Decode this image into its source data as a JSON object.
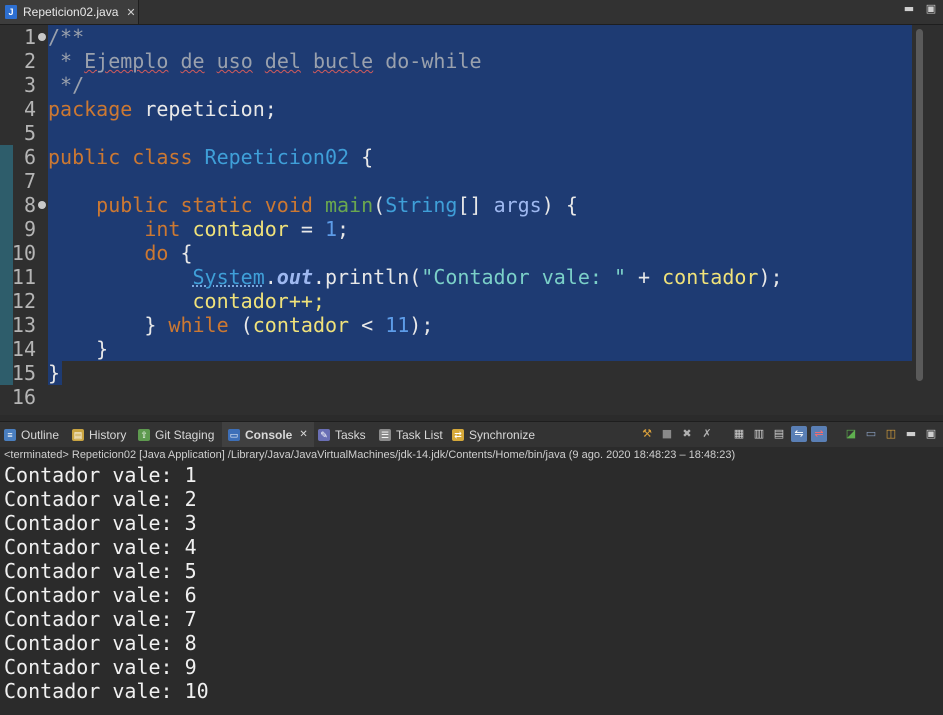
{
  "editor_tab": {
    "title": "Repeticion02.java",
    "close": "✕"
  },
  "window_buttons": {
    "minimize": "▬",
    "maximize": "▣"
  },
  "code": {
    "line_numbers": [
      "1",
      "2",
      "3",
      "4",
      "5",
      "6",
      "7",
      "8",
      "9",
      "10",
      "11",
      "12",
      "13",
      "14",
      "15",
      "16"
    ],
    "l1": "/**",
    "l2_a": " * ",
    "l2_b": "Ejemplo",
    "l2_c": " ",
    "l2_d": "de",
    "l2_e": " ",
    "l2_f": "uso",
    "l2_g": " ",
    "l2_h": "del",
    "l2_i": " ",
    "l2_j": "bucle",
    "l2_k": " do-while",
    "l3": " */",
    "l4_kw": "package",
    "l4_rest": " repeticion;",
    "l6_kw": "public class",
    "l6_cls": "Repeticion02",
    "l6_rest": " {",
    "l8_kw": "public static void",
    "l8_mth": "main",
    "l8_p1": "(",
    "l8_typ": "String",
    "l8_p2": "[] ",
    "l8_prm": "args",
    "l8_p3": ") {",
    "l9_kw": "int",
    "l9_var": "contador",
    "l9_eq": " = ",
    "l9_num": "1",
    "l9_end": ";",
    "l10_kw": "do",
    "l10_rest": " {",
    "l11_sys": "System",
    "l11_dot": ".",
    "l11_out": "out",
    "l11_m": ".println(",
    "l11_str": "\"Contador vale: \"",
    "l11_plus": " + ",
    "l11_var": "contador",
    "l11_end": ");",
    "l12": "contador++;",
    "l13_a": "} ",
    "l13_kw": "while",
    "l13_b": " (",
    "l13_var": "contador",
    "l13_c": " < ",
    "l13_num": "11",
    "l13_d": ");",
    "l14": "}",
    "l15": "}"
  },
  "views": {
    "tabs": [
      {
        "label": "Outline",
        "icon": "outline-icon"
      },
      {
        "label": "History",
        "icon": "history-icon"
      },
      {
        "label": "Git Staging",
        "icon": "git-staging-icon"
      },
      {
        "label": "Console",
        "icon": "console-icon",
        "close": "✕"
      },
      {
        "label": "Tasks",
        "icon": "tasks-icon"
      },
      {
        "label": "Task List",
        "icon": "task-list-icon"
      },
      {
        "label": "Synchronize",
        "icon": "synchronize-icon"
      }
    ]
  },
  "console": {
    "header": "<terminated> Repeticion02 [Java Application] /Library/Java/JavaVirtualMachines/jdk-14.jdk/Contents/Home/bin/java  (9 ago. 2020 18:48:23 – 18:48:23)",
    "lines": [
      "Contador vale: 1",
      "Contador vale: 2",
      "Contador vale: 3",
      "Contador vale: 4",
      "Contador vale: 5",
      "Contador vale: 6",
      "Contador vale: 7",
      "Contador vale: 8",
      "Contador vale: 9",
      "Contador vale: 10"
    ]
  },
  "colors": {
    "selection": "#1e3b73",
    "keyword": "#cc7832",
    "class": "#3f9fd8",
    "method": "#6aa84f",
    "variable": "#f0e27a",
    "number": "#5d9ce8",
    "string": "#7bd0c8"
  }
}
